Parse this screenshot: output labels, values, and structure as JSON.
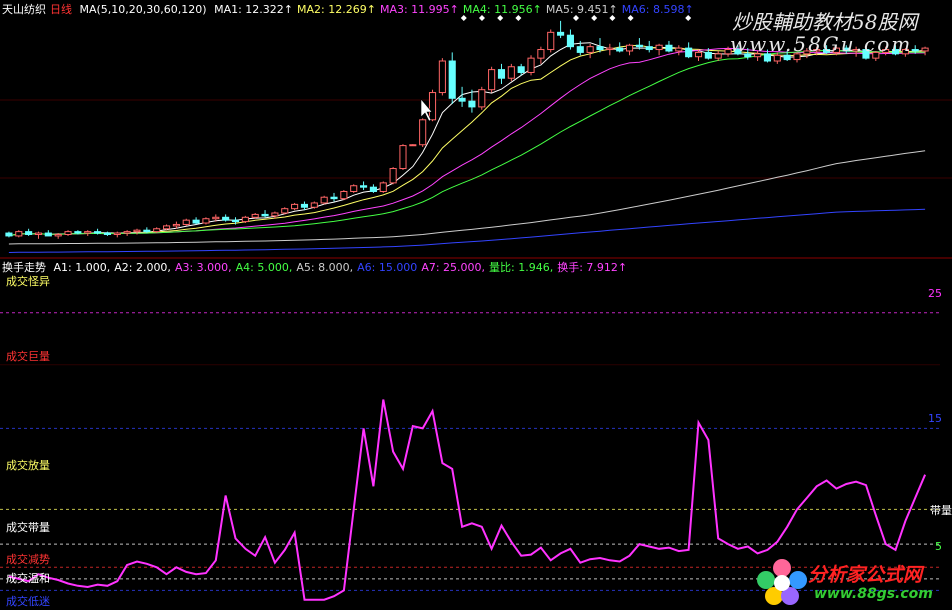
{
  "header": {
    "stock_name": "天山纺织",
    "period": "日线",
    "ma_params": "MA(5,10,20,30,60,120)",
    "ma_values": [
      {
        "label": "MA1: 12.322",
        "arrow": "↑",
        "color": "#ffffff"
      },
      {
        "label": "MA2: 12.269",
        "arrow": "↑",
        "color": "#ffff66"
      },
      {
        "label": "MA3: 11.995",
        "arrow": "↑",
        "color": "#ff44ff"
      },
      {
        "label": "MA4: 11.956",
        "arrow": "↑",
        "color": "#44ff44"
      },
      {
        "label": "MA5: 9.451",
        "arrow": "↑",
        "color": "#cccccc"
      },
      {
        "label": "MA6: 8.598",
        "arrow": "↑",
        "color": "#3344ff"
      }
    ]
  },
  "indicator_header": {
    "name": "换手走势",
    "items": [
      {
        "label": "A1: 1.000,",
        "color": "#ffffff"
      },
      {
        "label": "A2: 2.000,",
        "color": "#ffffff"
      },
      {
        "label": "A3: 3.000,",
        "color": "#ff44ff"
      },
      {
        "label": "A4: 5.000,",
        "color": "#44ff44"
      },
      {
        "label": "A5: 8.000,",
        "color": "#cccccc"
      },
      {
        "label": "A6: 15.000",
        "color": "#3344ff"
      },
      {
        "label": "A7: 25.000,",
        "color": "#ff44ff"
      },
      {
        "label": "量比: 1.946,",
        "color": "#44ff44"
      },
      {
        "label": "换手: 7.912",
        "arrow": "↑",
        "color": "#ff44ff"
      }
    ]
  },
  "zones": {
    "strange": {
      "label": "成交怪异",
      "color": "#ffff66"
    },
    "huge": {
      "label": "成交巨量",
      "color": "#ff3333"
    },
    "heavy": {
      "label": "成交放量",
      "color": "#ffff66"
    },
    "normal": {
      "label": "成交带量",
      "color": "#ffffff"
    },
    "shrink": {
      "label": "成交减势",
      "color": "#ff3333"
    },
    "mild": {
      "label": "成交温和",
      "color": "#ffffff"
    },
    "low": {
      "label": "成交低迷",
      "color": "#3344ff"
    }
  },
  "axis_labels": {
    "top": "25",
    "mid": "15",
    "low": "5",
    "right_tag": "带量"
  },
  "watermarks": {
    "top": "炒股輔助教材58股网",
    "top_url": "www.58Gu.com",
    "logo_name": "分析家公式网",
    "logo_url": "www.88gs.com"
  },
  "colors": {
    "up": "#ff6666",
    "down": "#66ffff",
    "turnover": "#ff33ff",
    "grid": "#8b0000"
  },
  "chart_data": [
    {
      "type": "candlestick",
      "title": "天山纺织 日线",
      "x_count": 94,
      "ylim": [
        5.5,
        13.8
      ],
      "candles": [
        [
          6.3,
          6.35,
          6.15,
          6.2
        ],
        [
          6.2,
          6.4,
          6.15,
          6.35
        ],
        [
          6.35,
          6.45,
          6.2,
          6.25
        ],
        [
          6.25,
          6.35,
          6.1,
          6.3
        ],
        [
          6.3,
          6.4,
          6.2,
          6.2
        ],
        [
          6.2,
          6.3,
          6.1,
          6.25
        ],
        [
          6.25,
          6.4,
          6.2,
          6.35
        ],
        [
          6.35,
          6.4,
          6.25,
          6.3
        ],
        [
          6.3,
          6.4,
          6.2,
          6.35
        ],
        [
          6.35,
          6.45,
          6.25,
          6.3
        ],
        [
          6.3,
          6.35,
          6.2,
          6.25
        ],
        [
          6.25,
          6.35,
          6.15,
          6.3
        ],
        [
          6.3,
          6.4,
          6.2,
          6.35
        ],
        [
          6.35,
          6.45,
          6.25,
          6.4
        ],
        [
          6.4,
          6.5,
          6.3,
          6.35
        ],
        [
          6.35,
          6.5,
          6.3,
          6.45
        ],
        [
          6.45,
          6.6,
          6.4,
          6.55
        ],
        [
          6.55,
          6.7,
          6.45,
          6.6
        ],
        [
          6.6,
          6.8,
          6.55,
          6.75
        ],
        [
          6.75,
          6.85,
          6.6,
          6.65
        ],
        [
          6.65,
          6.85,
          6.6,
          6.8
        ],
        [
          6.8,
          6.95,
          6.7,
          6.85
        ],
        [
          6.85,
          6.95,
          6.7,
          6.75
        ],
        [
          6.75,
          6.85,
          6.6,
          6.7
        ],
        [
          6.7,
          6.9,
          6.65,
          6.85
        ],
        [
          6.85,
          7.0,
          6.8,
          6.95
        ],
        [
          6.95,
          7.1,
          6.85,
          6.9
        ],
        [
          6.9,
          7.05,
          6.8,
          7.0
        ],
        [
          7.0,
          7.2,
          6.95,
          7.15
        ],
        [
          7.15,
          7.35,
          7.1,
          7.3
        ],
        [
          7.3,
          7.4,
          7.1,
          7.2
        ],
        [
          7.2,
          7.4,
          7.15,
          7.35
        ],
        [
          7.35,
          7.6,
          7.3,
          7.55
        ],
        [
          7.55,
          7.7,
          7.4,
          7.5
        ],
        [
          7.5,
          7.8,
          7.45,
          7.75
        ],
        [
          7.75,
          8.0,
          7.7,
          7.95
        ],
        [
          7.95,
          8.1,
          7.8,
          7.9
        ],
        [
          7.9,
          8.0,
          7.7,
          7.75
        ],
        [
          7.75,
          8.1,
          7.7,
          8.05
        ],
        [
          8.05,
          8.6,
          8.0,
          8.55
        ],
        [
          8.55,
          9.4,
          8.5,
          9.35
        ],
        [
          9.35,
          9.4,
          9.35,
          9.38
        ],
        [
          9.38,
          10.3,
          9.3,
          10.25
        ],
        [
          10.25,
          11.3,
          10.2,
          11.2
        ],
        [
          11.2,
          12.4,
          11.1,
          12.3
        ],
        [
          12.3,
          12.6,
          10.8,
          11.0
        ],
        [
          11.0,
          11.4,
          10.7,
          10.9
        ],
        [
          10.9,
          11.3,
          10.5,
          10.7
        ],
        [
          10.7,
          11.4,
          10.6,
          11.3
        ],
        [
          11.3,
          12.1,
          11.2,
          12.0
        ],
        [
          12.0,
          12.2,
          11.5,
          11.7
        ],
        [
          11.7,
          12.2,
          11.6,
          12.1
        ],
        [
          12.1,
          12.2,
          11.8,
          11.9
        ],
        [
          11.9,
          12.5,
          11.8,
          12.4
        ],
        [
          12.4,
          12.8,
          12.2,
          12.7
        ],
        [
          12.7,
          13.4,
          12.6,
          13.3
        ],
        [
          13.3,
          13.7,
          13.1,
          13.2
        ],
        [
          13.2,
          13.4,
          12.7,
          12.8
        ],
        [
          12.8,
          13.0,
          12.5,
          12.6
        ],
        [
          12.6,
          12.9,
          12.4,
          12.8
        ],
        [
          12.8,
          13.1,
          12.6,
          12.7
        ],
        [
          12.7,
          12.9,
          12.5,
          12.75
        ],
        [
          12.75,
          12.95,
          12.6,
          12.65
        ],
        [
          12.65,
          12.9,
          12.5,
          12.85
        ],
        [
          12.85,
          13.1,
          12.7,
          12.8
        ],
        [
          12.8,
          13.0,
          12.6,
          12.7
        ],
        [
          12.7,
          12.9,
          12.5,
          12.85
        ],
        [
          12.85,
          13.0,
          12.6,
          12.65
        ],
        [
          12.65,
          12.85,
          12.5,
          12.75
        ],
        [
          12.75,
          12.95,
          12.4,
          12.45
        ],
        [
          12.45,
          12.7,
          12.3,
          12.6
        ],
        [
          12.6,
          12.75,
          12.35,
          12.4
        ],
        [
          12.4,
          12.65,
          12.3,
          12.55
        ],
        [
          12.55,
          12.8,
          12.45,
          12.7
        ],
        [
          12.7,
          12.85,
          12.5,
          12.55
        ],
        [
          12.55,
          12.75,
          12.35,
          12.45
        ],
        [
          12.45,
          12.65,
          12.3,
          12.55
        ],
        [
          12.55,
          12.7,
          12.25,
          12.3
        ],
        [
          12.3,
          12.6,
          12.2,
          12.5
        ],
        [
          12.5,
          12.65,
          12.3,
          12.35
        ],
        [
          12.35,
          12.6,
          12.25,
          12.55
        ],
        [
          12.55,
          12.75,
          12.4,
          12.65
        ],
        [
          12.65,
          12.8,
          12.5,
          12.7
        ],
        [
          12.7,
          12.85,
          12.55,
          12.6
        ],
        [
          12.6,
          12.8,
          12.5,
          12.75
        ],
        [
          12.75,
          12.85,
          12.55,
          12.65
        ],
        [
          12.65,
          12.8,
          12.45,
          12.7
        ],
        [
          12.7,
          12.8,
          12.35,
          12.4
        ],
        [
          12.4,
          12.65,
          12.3,
          12.6
        ],
        [
          12.6,
          12.8,
          12.5,
          12.7
        ],
        [
          12.7,
          12.85,
          12.5,
          12.55
        ],
        [
          12.55,
          12.75,
          12.45,
          12.7
        ],
        [
          12.7,
          12.85,
          12.55,
          12.65
        ],
        [
          12.65,
          12.8,
          12.5,
          12.75
        ]
      ],
      "markers": [
        48,
        50,
        52,
        54,
        60,
        62,
        64,
        66,
        72
      ]
    },
    {
      "type": "line",
      "title": "换手走势",
      "ylim": [
        0,
        28
      ],
      "reference_levels": [
        1,
        2,
        3,
        5,
        8,
        15,
        25
      ],
      "series": [
        {
          "name": "换手",
          "values": [
            2.2,
            2.0,
            1.8,
            2.4,
            2.1,
            1.9,
            1.6,
            1.4,
            1.3,
            1.5,
            1.4,
            1.8,
            3.2,
            3.5,
            3.3,
            3.0,
            2.4,
            3.0,
            2.6,
            2.4,
            2.5,
            3.6,
            9.2,
            5.5,
            4.6,
            4.0,
            5.6,
            3.4,
            4.5,
            6.0,
            0.2,
            0.2,
            0.2,
            0.5,
            1.0,
            8.0,
            15.0,
            10.0,
            17.5,
            13.0,
            11.5,
            15.2,
            15.0,
            16.5,
            12.0,
            11.5,
            6.5,
            6.8,
            6.5,
            4.6,
            6.6,
            5.2,
            4.0,
            4.1,
            4.7,
            3.6,
            4.2,
            4.6,
            3.4,
            3.7,
            3.8,
            3.6,
            3.5,
            4.0,
            5.0,
            4.8,
            4.6,
            4.7,
            4.4,
            4.5,
            15.5,
            14.0,
            5.5,
            5.0,
            4.6,
            4.8,
            4.2,
            4.5,
            5.2,
            6.5,
            8.0,
            9.0,
            10.0,
            10.5,
            9.8,
            10.2,
            10.4,
            10.1,
            7.5,
            5.0,
            4.5,
            7.0,
            9.0,
            11.0
          ]
        }
      ]
    }
  ]
}
